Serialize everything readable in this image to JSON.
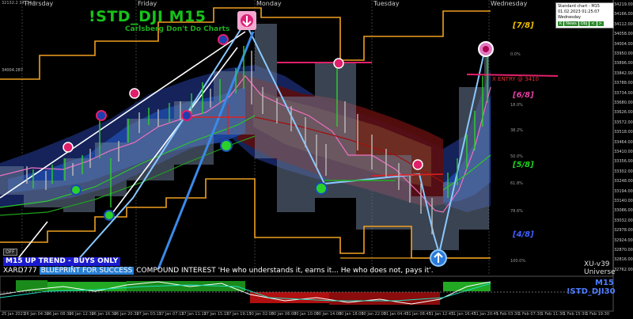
{
  "colors": {
    "background": "#000000",
    "title_green": "#17c21a",
    "band_navy": "#1a2a66",
    "band_grey": "#5f6f88",
    "band_maroon": "#5a0d0d",
    "murrey_orange": "#f0a020",
    "trend_bg": "#1a1acf",
    "blueprint_bg": "#2a7fd3"
  },
  "chart": {
    "title": "!STD_DJI M15",
    "subtitle": "Carlsberg Don't Do Charts",
    "day_labels": [
      "Thursday",
      "Friday",
      "Monday",
      "Tuesday",
      "Wednesday"
    ],
    "murrey_levels": [
      {
        "label": "[7/8]",
        "color": "#f0c000"
      },
      {
        "label": "[6/8]",
        "color": "#e040a0"
      },
      {
        "label": "[5/8]",
        "color": "#20d020"
      },
      {
        "label": "[4/8]",
        "color": "#4060ff"
      }
    ],
    "x_entry_label": "X ENTRY @ 3410",
    "percent_labels": [
      "0.0%",
      "18.0%",
      "38.2%",
      "50.0%",
      "61.8%",
      "78.6%",
      "100.0%"
    ],
    "trend_label": "M15 UP TREND - BUYS ONLY",
    "tagline": {
      "prefix": "XARD777",
      "highlight": "BLUEPRINT FOR SUCCESS",
      "text": "COMPOUND INTEREST  'He who understands it, earns it... He who does not, pays it'."
    },
    "xu_version": "XU-v39",
    "xu_universe": "Universe",
    "lower_timeframe": "M15",
    "lower_symbol": "!STD_DJI30",
    "off_button": "OFF",
    "top_info": "32132.2  34134.8",
    "left_price": "34004.287",
    "price_ticks": [
      "34219.00",
      "34166.00",
      "34112.00",
      "34058.00",
      "34004.00",
      "33950.00",
      "33896.00",
      "33842.00",
      "33788.00",
      "33734.00",
      "33680.00",
      "33626.00",
      "33572.00",
      "33518.00",
      "33464.00",
      "33410.00",
      "33356.00",
      "33302.00",
      "33248.00",
      "33194.00",
      "33140.00",
      "33086.00",
      "33032.00",
      "32978.00",
      "32924.00",
      "32870.00",
      "32816.00",
      "32762.00"
    ],
    "time_ticks": [
      "25 Jan 2023",
      "26 Jan 04:30",
      "26 Jan 08:30",
      "26 Jan 12:30",
      "26 Jan 16:30",
      "26 Jan 20:30",
      "27 Jan 03:15",
      "27 Jan 07:15",
      "27 Jan 11:15",
      "27 Jan 15:15",
      "27 Jan 19:15",
      "30 Jan 02:00",
      "30 Jan 06:00",
      "30 Jan 10:00",
      "30 Jan 14:00",
      "30 Jan 18:00",
      "30 Jan 22:00",
      "31 Jan 04:45",
      "31 Jan 08:45",
      "31 Jan 12:45",
      "31 Jan 16:45",
      "31 Jan 20:45",
      "1 Feb 03:30",
      "1 Feb 07:30",
      "1 Feb 11:30",
      "1 Feb 15:30",
      "1 Feb 19:30"
    ]
  },
  "info_panel": {
    "line1": "Standard chart - M15",
    "line2": "01.02.2023    01:25:07",
    "line3": "Wednesday",
    "buttons": [
      "K",
      "News",
      "Obj",
      "<",
      ">"
    ]
  }
}
